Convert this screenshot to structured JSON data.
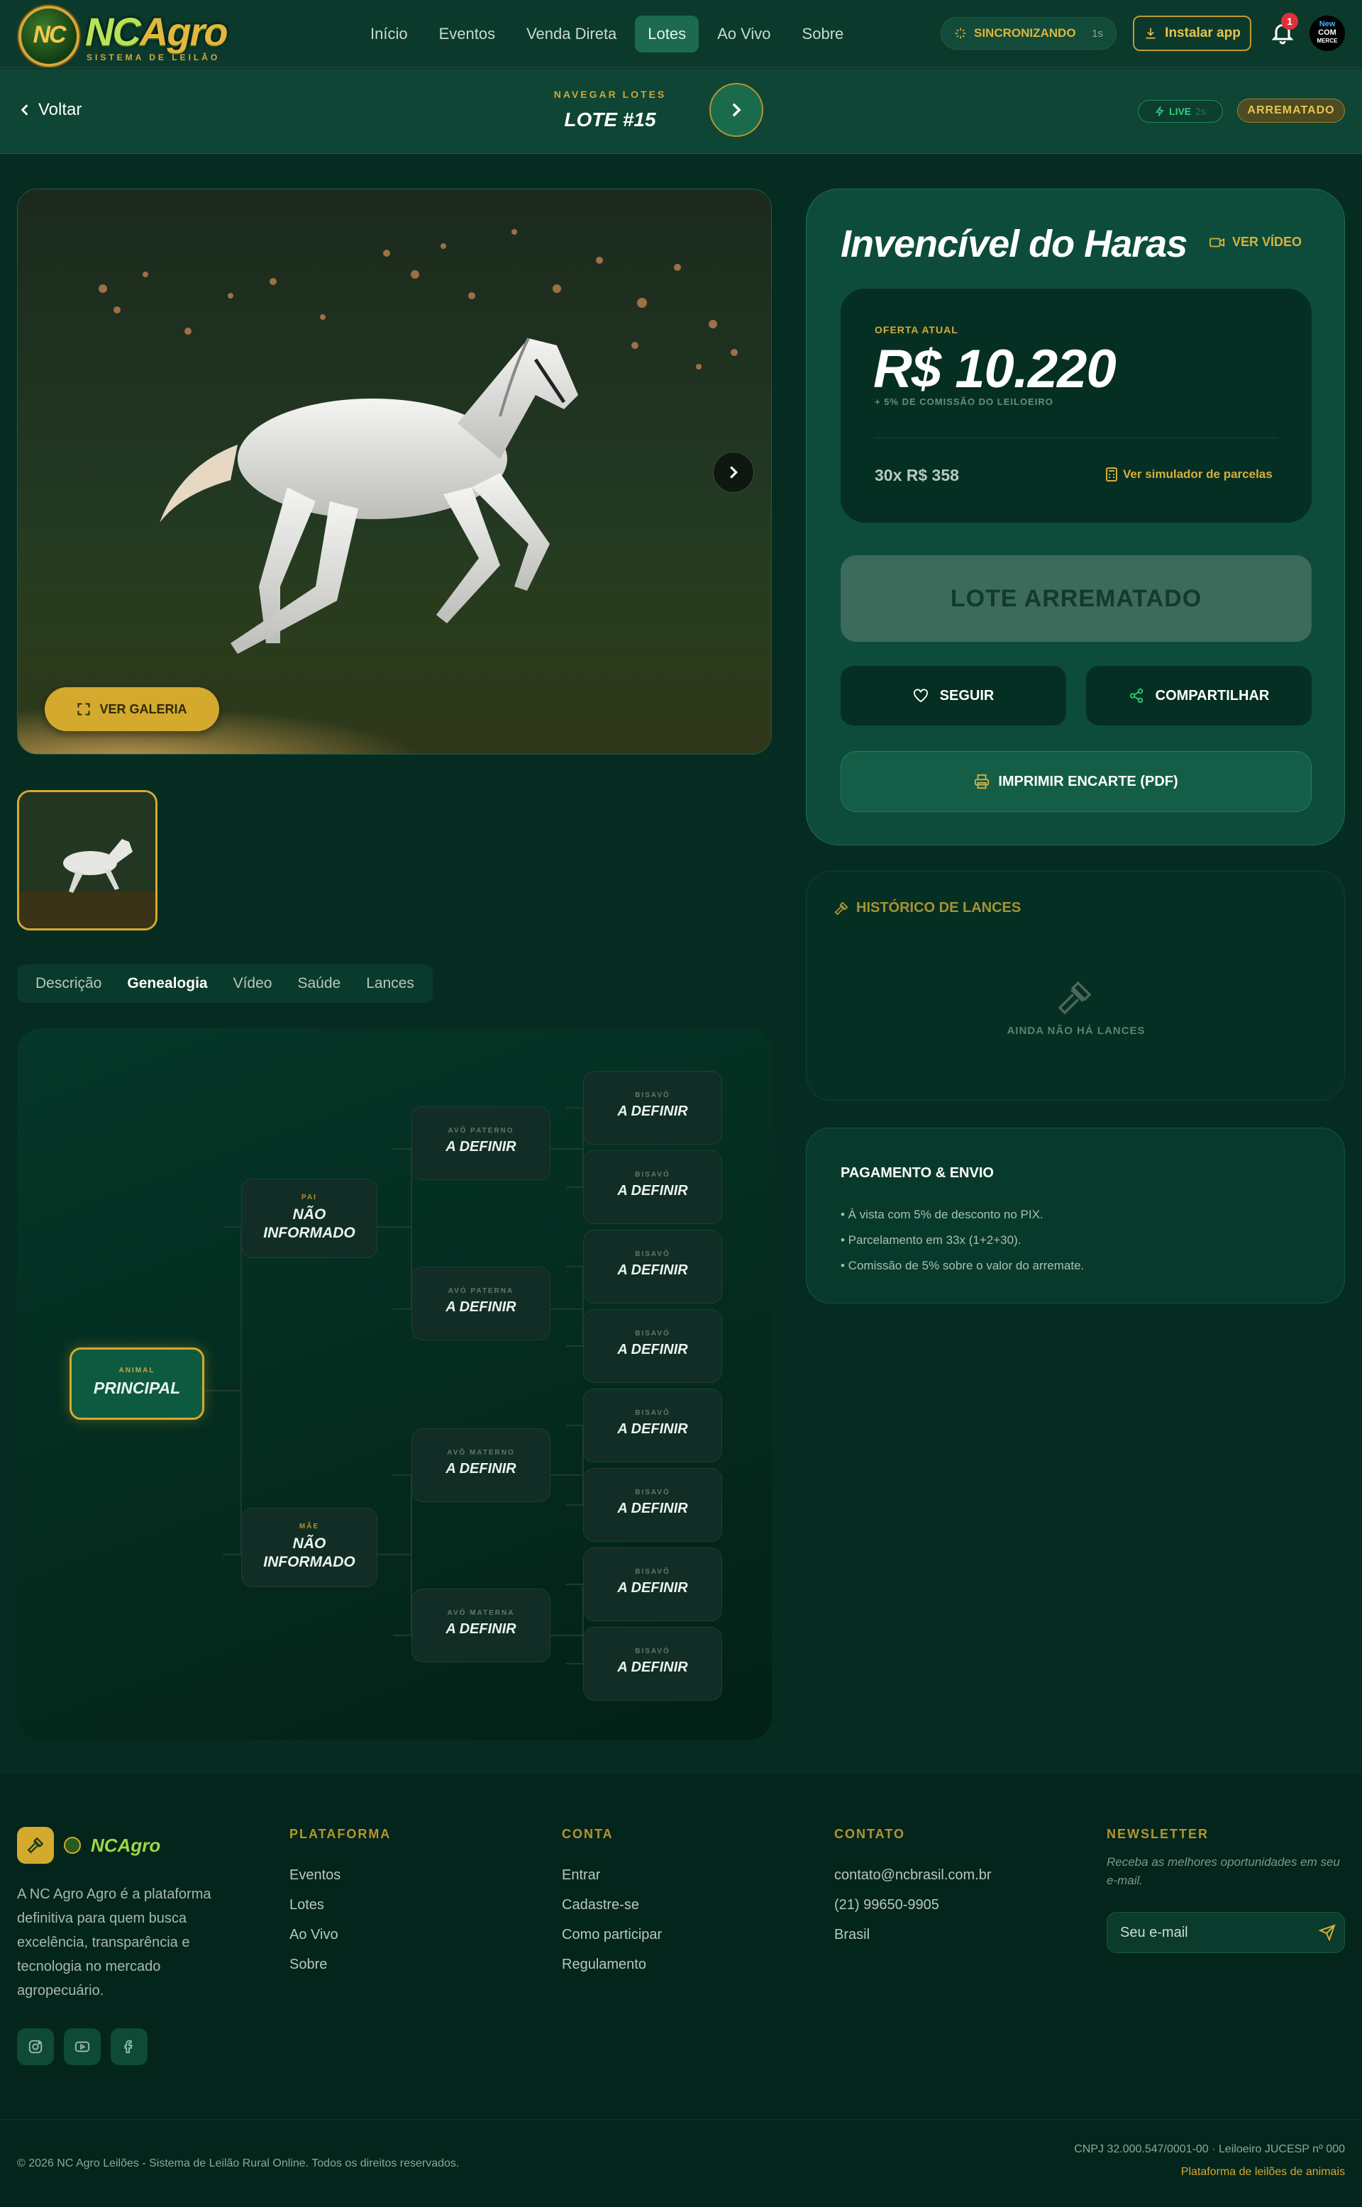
{
  "header": {
    "logo_mark": "NC",
    "logo_word_a": "NC",
    "logo_word_b": "Agro",
    "logo_sub": "SISTEMA DE LEILÃO",
    "nav": [
      "Início",
      "Eventos",
      "Venda Direta",
      "Lotes",
      "Ao Vivo",
      "Sobre"
    ],
    "nav_active": "Lotes",
    "sync_label": "SINCRONIZANDO",
    "sync_time": "1s",
    "install_label": "Instalar app",
    "notif_count": "1",
    "avatar_lines": [
      "New",
      "COM",
      "MERCE"
    ]
  },
  "subbar": {
    "back_label": "Voltar",
    "nav_label": "NAVEGAR LOTES",
    "lot": "LOTE #15",
    "live_label": "LIVE",
    "live_time": "2s",
    "status": "ARREMATADO"
  },
  "media": {
    "gallery_label": "VER GALERIA"
  },
  "tabs": [
    "Descrição",
    "Genealogia",
    "Vídeo",
    "Saúde",
    "Lances"
  ],
  "tab_active": "Genealogia",
  "genealogy": {
    "main": {
      "label": "ANIMAL",
      "value": "PRINCIPAL"
    },
    "father": {
      "label": "PAI",
      "value": "NÃO INFORMADO"
    },
    "mother": {
      "label": "MÃE",
      "value": "NÃO INFORMADO"
    },
    "grandparents": [
      {
        "label": "AVÔ PATERNO",
        "value": "A DEFINIR"
      },
      {
        "label": "AVÓ PATERNA",
        "value": "A DEFINIR"
      },
      {
        "label": "AVÔ MATERNO",
        "value": "A DEFINIR"
      },
      {
        "label": "AVÓ MATERNA",
        "value": "A DEFINIR"
      }
    ],
    "great": [
      {
        "label": "BISAVÔ",
        "value": "A DEFINIR"
      },
      {
        "label": "BISAVÓ",
        "value": "A DEFINIR"
      },
      {
        "label": "BISAVÔ",
        "value": "A DEFINIR"
      },
      {
        "label": "BISAVÓ",
        "value": "A DEFINIR"
      },
      {
        "label": "BISAVÔ",
        "value": "A DEFINIR"
      },
      {
        "label": "BISAVÓ",
        "value": "A DEFINIR"
      },
      {
        "label": "BISAVÔ",
        "value": "A DEFINIR"
      },
      {
        "label": "BISAVÓ",
        "value": "A DEFINIR"
      }
    ]
  },
  "lot": {
    "name": "Invencível do Haras",
    "video_label": "VER VÍDEO",
    "offer_label": "OFERTA ATUAL",
    "offer_value": "R$ 10.220",
    "commission": "+ 5% DE COMISSÃO DO LEILOEIRO",
    "installments": "30x R$ 358",
    "simulator_label": "Ver simulador de parcelas",
    "sold_label": "LOTE ARREMATADO",
    "follow_label": "SEGUIR",
    "share_label": "COMPARTILHAR",
    "print_label": "IMPRIMIR ENCARTE (PDF)"
  },
  "history": {
    "title": "HISTÓRICO DE LANCES",
    "empty": "AINDA NÃO HÁ LANCES"
  },
  "payment": {
    "title": "PAGAMENTO & ENVIO",
    "items": [
      "• À vista com 5% de desconto no PIX.",
      "• Parcelamento em 33x (1+2+30).",
      "• Comissão de 5% sobre o valor do arremate."
    ]
  },
  "footer": {
    "brand": "NCAgro",
    "description": "A NC Agro Agro é a plataforma definitiva para quem busca excelência, transparência e tecnologia no mercado agropecuário.",
    "platform": {
      "title": "PLATAFORMA",
      "links": [
        "Eventos",
        "Lotes",
        "Ao Vivo",
        "Sobre"
      ]
    },
    "account": {
      "title": "CONTA",
      "links": [
        "Entrar",
        "Cadastre-se",
        "Como participar",
        "Regulamento"
      ]
    },
    "contact": {
      "title": "CONTATO",
      "links": [
        "contato@ncbrasil.com.br",
        "(21) 99650-9905",
        "Brasil"
      ]
    },
    "newsletter": {
      "title": "NEWSLETTER",
      "text": "Receba as melhores oportunidades em seu e-mail.",
      "placeholder": "Seu e-mail"
    },
    "copyright": "© 2026 NC Agro Leilões - Sistema de Leilão Rural Online. Todos os direitos reservados.",
    "cnpj": "CNPJ 32.000.547/0001-00 · Leiloeiro JUCESP nº 000",
    "tagline": "Plataforma de leilões de animais"
  },
  "colors": {
    "bg": "#062c22",
    "accent": "#d4aa2e",
    "card": "#0d4c3a",
    "live": "#2fd17a"
  }
}
